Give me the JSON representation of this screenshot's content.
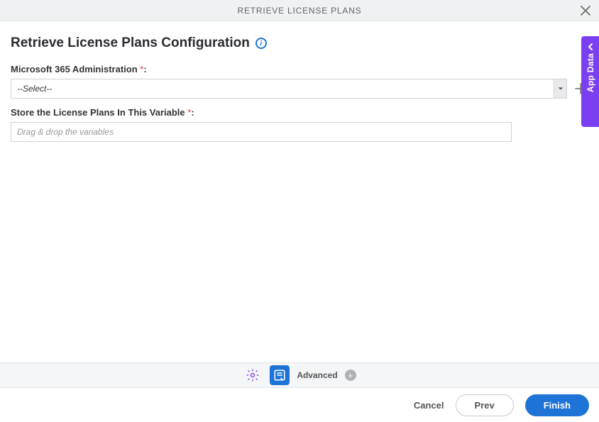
{
  "header": {
    "title": "RETRIEVE LICENSE PLANS"
  },
  "page": {
    "title": "Retrieve License Plans Configuration"
  },
  "fields": {
    "admin": {
      "label": "Microsoft 365 Administration ",
      "required_marker": "*",
      "colon": ":",
      "selected": "--Select--"
    },
    "store_var": {
      "label": "Store the License Plans In This Variable ",
      "required_marker": "*",
      "colon": ":",
      "placeholder": "Drag & drop the variables"
    }
  },
  "side_panel": {
    "label": "App Data"
  },
  "toolbar": {
    "advanced_label": "Advanced"
  },
  "footer": {
    "cancel": "Cancel",
    "prev": "Prev",
    "finish": "Finish"
  },
  "info_icon_text": "i"
}
